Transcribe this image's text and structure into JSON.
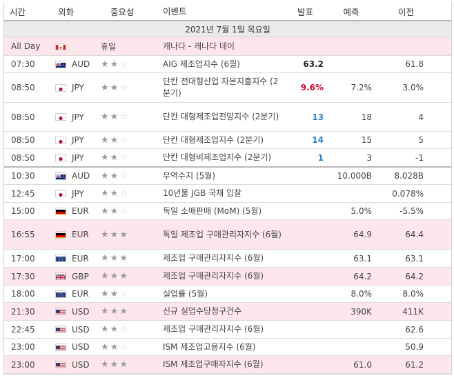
{
  "header": {
    "time": "시간",
    "currency": "외화",
    "importance": "중요성",
    "event": "이벤트",
    "actual": "발표",
    "forecast": "예측",
    "previous": "이전"
  },
  "date_label": "2021년 7월 1일 목요일",
  "colors": {
    "accent_red": "#c8102e",
    "accent_blue": "#2a7fc4",
    "row_highlight": "#fde7ec"
  },
  "rows": [
    {
      "time": "All Day",
      "flag": "CA",
      "currency": "",
      "stars": 0,
      "importance_text": "휴일",
      "event": "캐나다 - 캐나다 데이",
      "actual": "",
      "actual_color": "",
      "forecast": "",
      "previous": "",
      "pink": true,
      "thick": false,
      "h": 27
    },
    {
      "time": "07:30",
      "flag": "AU",
      "currency": "AUD",
      "stars": 2,
      "importance_text": "",
      "event": "AIG 제조업지수 (6월)",
      "actual": "63.2",
      "actual_color": "black",
      "forecast": "",
      "previous": "61.8",
      "pink": false,
      "thick": false,
      "h": 25
    },
    {
      "time": "08:50",
      "flag": "JP",
      "currency": "JPY",
      "stars": 2,
      "importance_text": "",
      "event": "단칸 전대형산업 자본지출지수 (2분기)",
      "actual": "9.6%",
      "actual_color": "red",
      "forecast": "7.2%",
      "previous": "3.0%",
      "pink": false,
      "thick": false,
      "h": 43
    },
    {
      "time": "08:50",
      "flag": "JP",
      "currency": "JPY",
      "stars": 2,
      "importance_text": "",
      "event": "단칸 대형제조업전망지수 (2분기)",
      "actual": "13",
      "actual_color": "blue",
      "forecast": "18",
      "previous": "4",
      "pink": false,
      "thick": false,
      "h": 42
    },
    {
      "time": "08:50",
      "flag": "JP",
      "currency": "JPY",
      "stars": 2,
      "importance_text": "",
      "event": "단칸 대형제조업지수 (2분기)",
      "actual": "14",
      "actual_color": "blue",
      "forecast": "15",
      "previous": "5",
      "pink": false,
      "thick": false,
      "h": 25
    },
    {
      "time": "08:50",
      "flag": "JP",
      "currency": "JPY",
      "stars": 2,
      "importance_text": "",
      "event": "단칸 대형비제조업지수 (2분기)",
      "actual": "1",
      "actual_color": "blue",
      "forecast": "3",
      "previous": "-1",
      "pink": false,
      "thick": true,
      "h": 27
    },
    {
      "time": "10:30",
      "flag": "AU",
      "currency": "AUD",
      "stars": 2,
      "importance_text": "",
      "event": "무역수지 (5월)",
      "actual": "",
      "actual_color": "",
      "forecast": "10.000B",
      "previous": "8.028B",
      "pink": false,
      "thick": false,
      "h": 25
    },
    {
      "time": "12:45",
      "flag": "JP",
      "currency": "JPY",
      "stars": 2,
      "importance_text": "",
      "event": "10년물 JGB 국채 입찰",
      "actual": "",
      "actual_color": "",
      "forecast": "",
      "previous": "0.078%",
      "pink": false,
      "thick": false,
      "h": 26
    },
    {
      "time": "15:00",
      "flag": "DE",
      "currency": "EUR",
      "stars": 2,
      "importance_text": "",
      "event": "독일 소매판매 (MoM) (5월)",
      "actual": "",
      "actual_color": "",
      "forecast": "5.0%",
      "previous": "-5.5%",
      "pink": false,
      "thick": false,
      "h": 25
    },
    {
      "time": "16:55",
      "flag": "DE",
      "currency": "EUR",
      "stars": 3,
      "importance_text": "",
      "event": "독일 제조업 구매관리자지수 (6월)",
      "actual": "",
      "actual_color": "",
      "forecast": "64.9",
      "previous": "64.4",
      "pink": true,
      "thick": false,
      "h": 43
    },
    {
      "time": "17:00",
      "flag": "EU",
      "currency": "EUR",
      "stars": 3,
      "importance_text": "",
      "event": "제조업 구매관리자지수 (6월)",
      "actual": "",
      "actual_color": "",
      "forecast": "63.1",
      "previous": "63.1",
      "pink": false,
      "thick": false,
      "h": 26
    },
    {
      "time": "17:30",
      "flag": "GB",
      "currency": "GBP",
      "stars": 3,
      "importance_text": "",
      "event": "제조업 구매관리자지수 (6월)",
      "actual": "",
      "actual_color": "",
      "forecast": "64.2",
      "previous": "64.2",
      "pink": true,
      "thick": false,
      "h": 26
    },
    {
      "time": "18:00",
      "flag": "EU",
      "currency": "EUR",
      "stars": 2,
      "importance_text": "",
      "event": "실업률 (5월)",
      "actual": "",
      "actual_color": "",
      "forecast": "8.0%",
      "previous": "8.0%",
      "pink": false,
      "thick": false,
      "h": 25
    },
    {
      "time": "21:30",
      "flag": "US",
      "currency": "USD",
      "stars": 3,
      "importance_text": "",
      "event": "신규 실업수당청구건수",
      "actual": "",
      "actual_color": "",
      "forecast": "390K",
      "previous": "411K",
      "pink": true,
      "thick": false,
      "h": 26
    },
    {
      "time": "22:45",
      "flag": "US",
      "currency": "USD",
      "stars": 2,
      "importance_text": "",
      "event": "제조업 구매관리자지수 (6월)",
      "actual": "",
      "actual_color": "",
      "forecast": "",
      "previous": "62.6",
      "pink": false,
      "thick": false,
      "h": 26
    },
    {
      "time": "23:00",
      "flag": "US",
      "currency": "USD",
      "stars": 2,
      "importance_text": "",
      "event": "ISM 제조업고용지수 (6월)",
      "actual": "",
      "actual_color": "",
      "forecast": "",
      "previous": "50.9",
      "pink": false,
      "thick": false,
      "h": 25
    },
    {
      "time": "23:00",
      "flag": "US",
      "currency": "USD",
      "stars": 3,
      "importance_text": "",
      "event": "ISM 제조업구매자지수 (6월)",
      "actual": "",
      "actual_color": "",
      "forecast": "61.0",
      "previous": "61.2",
      "pink": true,
      "thick": false,
      "h": 26
    }
  ]
}
